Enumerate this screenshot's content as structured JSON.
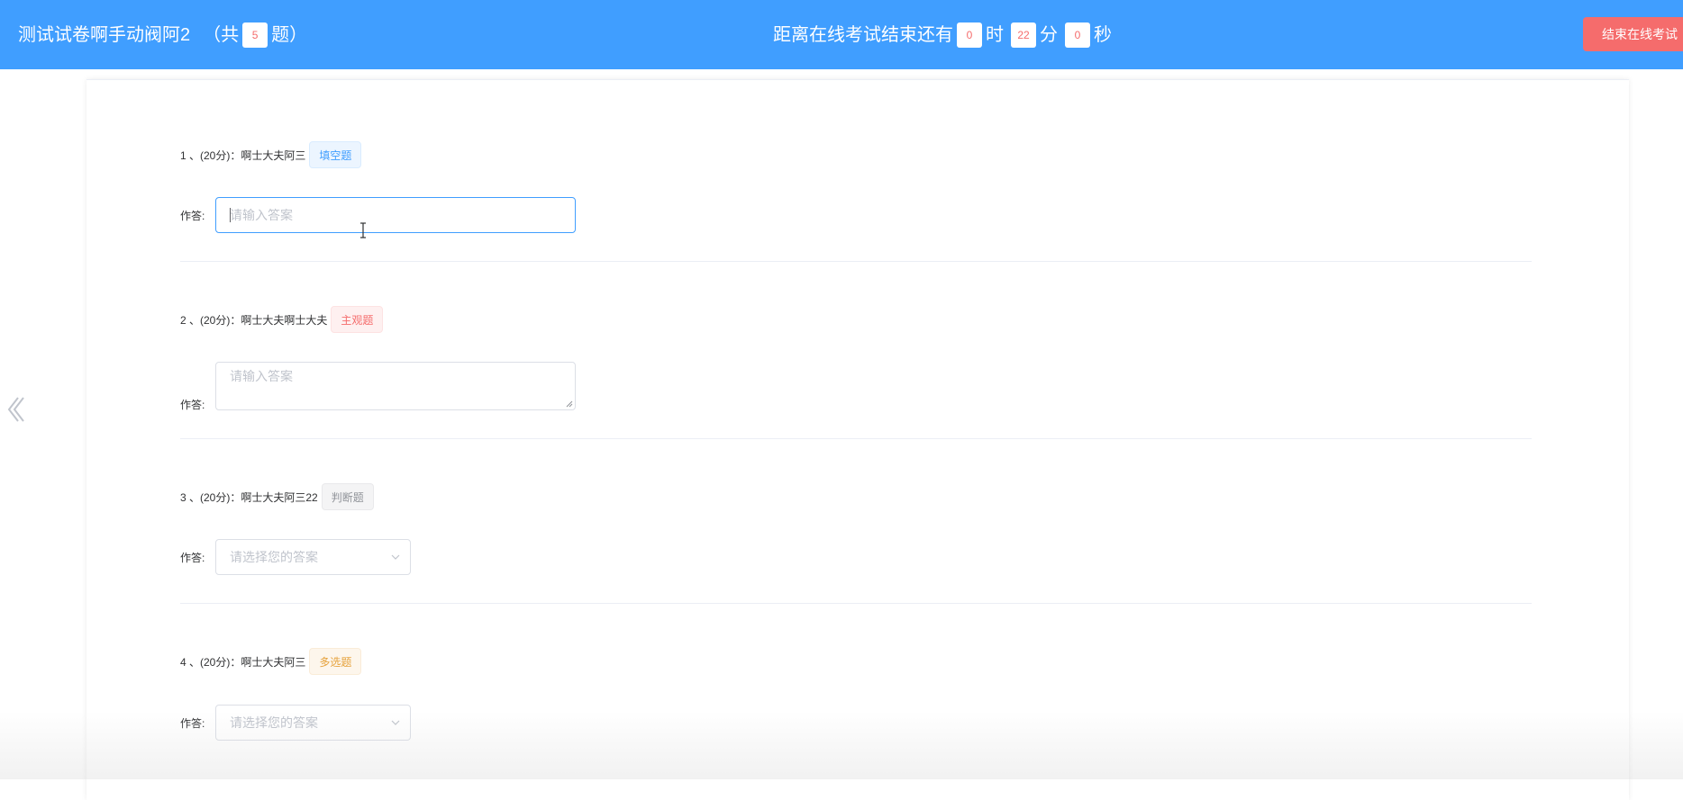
{
  "header": {
    "exam_title": "测试试卷啊手动阀阿2",
    "count_prefix": "（共",
    "question_count": "5",
    "count_suffix": "题）",
    "timer_prefix": "距离在线考试结束还有",
    "hours": "0",
    "hours_unit": "时",
    "minutes": "22",
    "minutes_unit": "分",
    "seconds": "0",
    "seconds_unit": "秒",
    "end_button_label": "结束在线考试"
  },
  "answer_label": "作答:",
  "questions": [
    {
      "prefix": "1 、(20分)：",
      "text": "啊士大夫阿三",
      "type_tag": "填空题",
      "input_placeholder": "请输入答案"
    },
    {
      "prefix": "2 、(20分)：",
      "text": "啊士大夫啊士大夫",
      "type_tag": "主观题",
      "input_placeholder": "请输入答案"
    },
    {
      "prefix": "3 、(20分)：",
      "text": "啊士大夫阿三22",
      "type_tag": "判断题",
      "input_placeholder": "请选择您的答案"
    },
    {
      "prefix": "4 、(20分)：",
      "text": "啊士大夫阿三",
      "type_tag": "多选题",
      "input_placeholder": "请选择您的答案"
    }
  ],
  "colors": {
    "header_bg": "#409eff",
    "end_button_bg": "#f56c6c",
    "count_text": "#f56c6c"
  },
  "icons": {
    "prev": "chevron-left-icon",
    "select": "chevron-down-icon",
    "cursor": "text-cursor-icon",
    "resize": "resize-handle-icon"
  }
}
